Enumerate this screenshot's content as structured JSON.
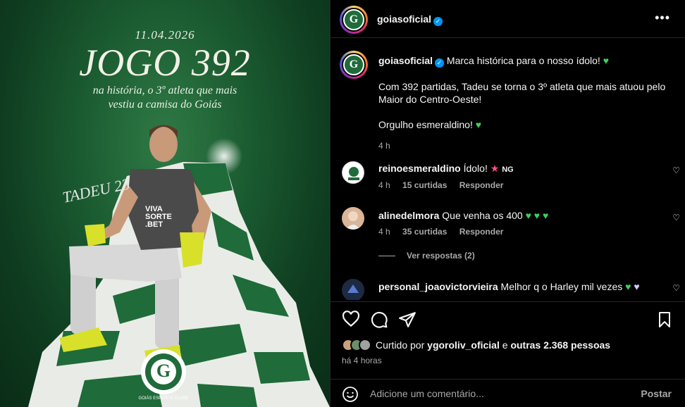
{
  "image": {
    "date": "11.04.2026",
    "headline": "JOGO 392",
    "sub_line1": "na história, o 3º atleta que mais",
    "sub_line2": "vestiu a camisa do Goiás",
    "signature": "TADEU 23",
    "jersey_sponsor1": "VIVA",
    "jersey_sponsor2": "SORTE",
    "jersey_sponsor3": ".BET",
    "badge_text": "GOIÁS ESPORTE CLUBE",
    "badge_letter": "G"
  },
  "header": {
    "username": "goiasoficial",
    "avatar_letter": "G",
    "more_icon": "more-horizontal-icon"
  },
  "caption": {
    "username": "goiasoficial",
    "line1": "Marca histórica para o nosso ídolo!",
    "para2": "Com 392 partidas, Tadeu se torna o 3º atleta que mais atuou pelo Maior do Centro-Oeste!",
    "para3": "Orgulho esmeraldino!",
    "time": "4 h"
  },
  "comments": [
    {
      "username": "reinoesmeraldino",
      "text": "Ídolo!",
      "suffix": "NG",
      "time": "4 h",
      "likes": "15 curtidas",
      "reply": "Responder"
    },
    {
      "username": "alinedelmora",
      "text": "Que venha os 400",
      "time": "4 h",
      "likes": "35 curtidas",
      "reply": "Responder",
      "view_replies": "Ver respostas (2)"
    },
    {
      "username": "personal_joaovictorvieira",
      "text": "Melhor q o Harley mil vezes"
    }
  ],
  "actions": {
    "liked_by_prefix": "Curtido por",
    "liked_by_user": "ygoroliv_oficial",
    "liked_by_and": "e",
    "liked_by_others": "outras 2.368 pessoas",
    "time_ago": "há 4 horas"
  },
  "add_comment": {
    "placeholder": "Adicione um comentário...",
    "post_label": "Postar"
  },
  "colors": {
    "accent_green": "#3fcf5c",
    "verified_blue": "#0095f6",
    "muted": "#a8a8a8"
  }
}
